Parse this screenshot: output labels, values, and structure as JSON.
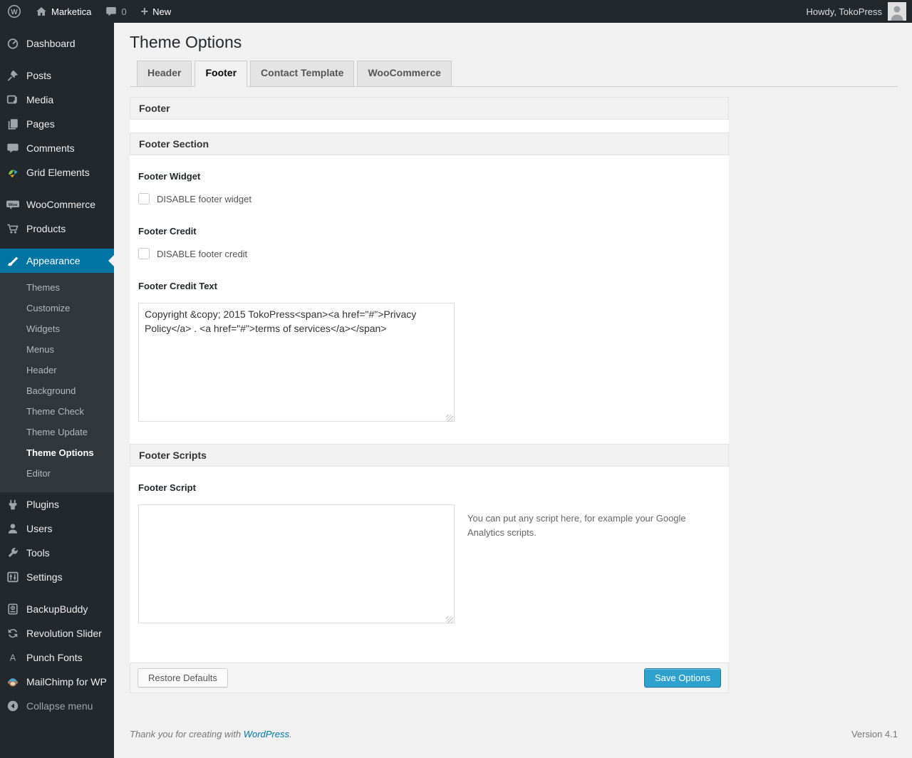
{
  "admin_bar": {
    "wp_logo_glyph": "W",
    "site_name": "Marketica",
    "comment_count": "0",
    "new_plus_glyph": "+",
    "new_label": "New",
    "howdy": "Howdy, TokoPress"
  },
  "sidebar": {
    "items": [
      {
        "label": "Dashboard"
      },
      {
        "label": "Posts"
      },
      {
        "label": "Media"
      },
      {
        "label": "Pages"
      },
      {
        "label": "Comments"
      },
      {
        "label": "Grid Elements"
      },
      {
        "label": "WooCommerce"
      },
      {
        "label": "Products"
      },
      {
        "label": "Appearance"
      },
      {
        "label": "Plugins"
      },
      {
        "label": "Users"
      },
      {
        "label": "Tools"
      },
      {
        "label": "Settings"
      },
      {
        "label": "BackupBuddy"
      },
      {
        "label": "Revolution Slider"
      },
      {
        "label": "Punch Fonts"
      },
      {
        "label": "MailChimp for WP"
      },
      {
        "label": "Collapse menu"
      }
    ],
    "appearance_submenu": [
      {
        "label": "Themes"
      },
      {
        "label": "Customize"
      },
      {
        "label": "Widgets"
      },
      {
        "label": "Menus"
      },
      {
        "label": "Header"
      },
      {
        "label": "Background"
      },
      {
        "label": "Theme Check"
      },
      {
        "label": "Theme Update"
      },
      {
        "label": "Theme Options"
      },
      {
        "label": "Editor"
      }
    ],
    "current_submenu_item": "Theme Options",
    "woocommerce_badge_glyph": "Woo",
    "punch_fonts_glyph": "A"
  },
  "main": {
    "page_title": "Theme Options",
    "tabs": [
      {
        "label": "Header",
        "active": false
      },
      {
        "label": "Footer",
        "active": true
      },
      {
        "label": "Contact Template",
        "active": false
      },
      {
        "label": "WooCommerce",
        "active": false
      }
    ],
    "footer_header": "Footer",
    "footer_section_header": "Footer Section",
    "footer_widget": {
      "label": "Footer Widget",
      "checkbox_label": "DISABLE footer widget",
      "checked": false
    },
    "footer_credit": {
      "label": "Footer Credit",
      "checkbox_label": "DISABLE footer credit",
      "checked": false
    },
    "footer_credit_text": {
      "label": "Footer Credit Text",
      "value": "Copyright &copy; 2015 TokoPress<span><a href=\"#\">Privacy Policy</a> . <a href=\"#\">terms of services</a></span>"
    },
    "footer_scripts_header": "Footer Scripts",
    "footer_script": {
      "label": "Footer Script",
      "value": "",
      "description": "You can put any script here, for example your Google Analytics scripts."
    },
    "actions": {
      "restore_label": "Restore Defaults",
      "save_label": "Save Options"
    }
  },
  "page_footer": {
    "thanks_prefix": "Thank you for creating with ",
    "wordpress_link": "WordPress",
    "thanks_suffix": ".",
    "version": "Version 4.1"
  },
  "colors": {
    "admin_dark": "#23282d",
    "submenu_bg": "#32373c",
    "active_accent": "#0074a2",
    "primary_button": "#2ea2cc",
    "page_background": "#f1f1f1",
    "link_blue": "#0074a2"
  }
}
